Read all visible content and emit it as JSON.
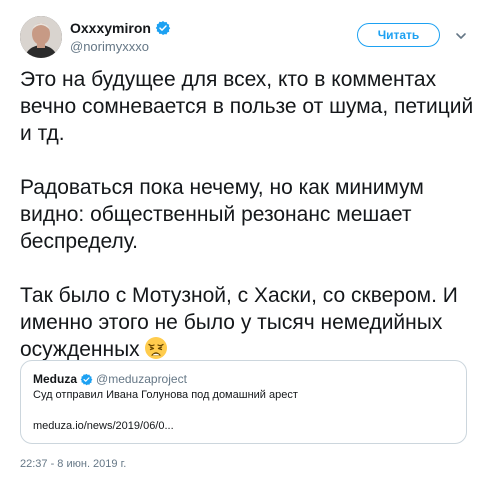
{
  "author": {
    "display_name": "Oxxxymiron",
    "handle": "@norimyxxxo",
    "verified": true
  },
  "follow_button": {
    "label": "Читать"
  },
  "tweet": {
    "paragraphs": [
      "Это на будущее для всех, кто в комментах вечно сомневается в пользе от шума, петиций и тд.",
      "Радоваться пока нечему, но как минимум видно: общественный резонанс мешает беспределу.",
      "Так было с Мотузной, с Хаски, со сквером. И именно этого не было у тысяч немедийных осужденных"
    ],
    "emoji": "weary-face"
  },
  "quote": {
    "name": "Meduza",
    "handle": "@meduzaproject",
    "verified": true,
    "text": "Суд отправил Ивана Голунова под домашний арест",
    "link": "meduza.io/news/2019/06/0..."
  },
  "timestamp": "22:37 - 8 июн. 2019 г.",
  "colors": {
    "accent": "#1da1f2",
    "text": "#14171a",
    "secondary": "#657786",
    "border": "#ccd6dd"
  }
}
